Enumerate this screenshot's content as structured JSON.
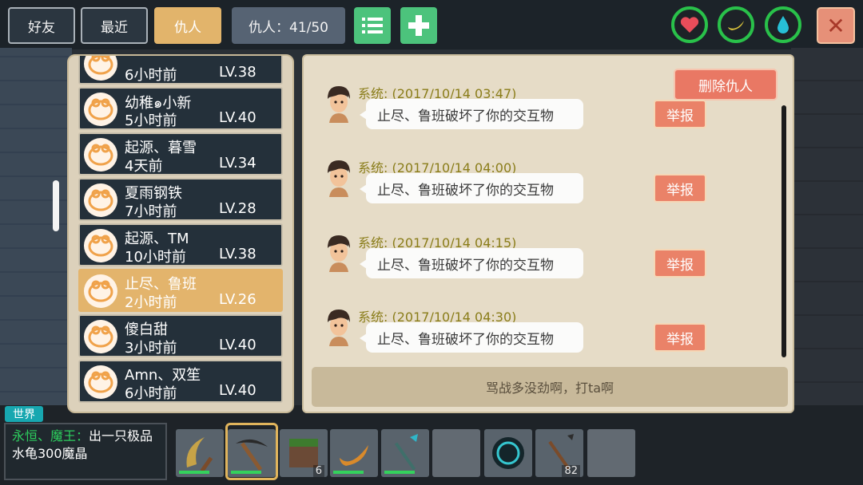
{
  "tabs": [
    {
      "label": "好友",
      "active": false
    },
    {
      "label": "最近",
      "active": false
    },
    {
      "label": "仇人",
      "active": true
    }
  ],
  "enemy_count": "仇人：41/50",
  "top_icons": {
    "list": "list-icon",
    "add": "plus-icon",
    "health": "heart-icon",
    "hunger": "banana-icon",
    "water": "water-drop-icon",
    "close": "close-icon"
  },
  "enemy_list": [
    {
      "name": "",
      "time": "6小时前",
      "level": "LV.38"
    },
    {
      "name": "幼稚๑小新",
      "time": "5小时前",
      "level": "LV.40"
    },
    {
      "name": "起源、暮雪",
      "time": "4天前",
      "level": "LV.34"
    },
    {
      "name": "夏雨钢铁",
      "time": "7小时前",
      "level": "LV.28"
    },
    {
      "name": "起源、TM",
      "time": "10小时前",
      "level": "LV.38"
    },
    {
      "name": "止尽、鲁班",
      "time": "2小时前",
      "level": "LV.26",
      "selected": true
    },
    {
      "name": "傻白甜",
      "time": "3小时前",
      "level": "LV.40"
    },
    {
      "name": "Amn、双笙",
      "time": "6小时前",
      "level": "LV.40"
    }
  ],
  "delete_enemy_label": "删除仇人",
  "messages": [
    {
      "sender": "系统:",
      "time": "(2017/10/14 03:47)",
      "text": "止尽、鲁班破坏了你的交互物",
      "report": "举报"
    },
    {
      "sender": "系统:",
      "time": "(2017/10/14 04:00)",
      "text": "止尽、鲁班破坏了你的交互物",
      "report": "举报"
    },
    {
      "sender": "系统:",
      "time": "(2017/10/14 04:15)",
      "text": "止尽、鲁班破坏了你的交互物",
      "report": "举报"
    },
    {
      "sender": "系统:",
      "time": "(2017/10/14 04:30)",
      "text": "止尽、鲁班破坏了你的交互物",
      "report": "举报"
    }
  ],
  "footer_text": "骂战多没劲啊，打ta啊",
  "world_tag": "世界",
  "chat": {
    "who": "永恒、魔王：",
    "text": "出一只极品水龟300魔晶"
  },
  "hotbar": [
    {
      "item": "sickle",
      "qty": ""
    },
    {
      "item": "pickaxe",
      "qty": "",
      "selected": true
    },
    {
      "item": "dirt-block",
      "qty": "6"
    },
    {
      "item": "banana",
      "qty": ""
    },
    {
      "item": "spear",
      "qty": ""
    },
    {
      "item": "empty",
      "qty": ""
    },
    {
      "item": "orb",
      "qty": ""
    },
    {
      "item": "arrow-spear",
      "qty": "82"
    },
    {
      "item": "empty",
      "qty": ""
    }
  ]
}
